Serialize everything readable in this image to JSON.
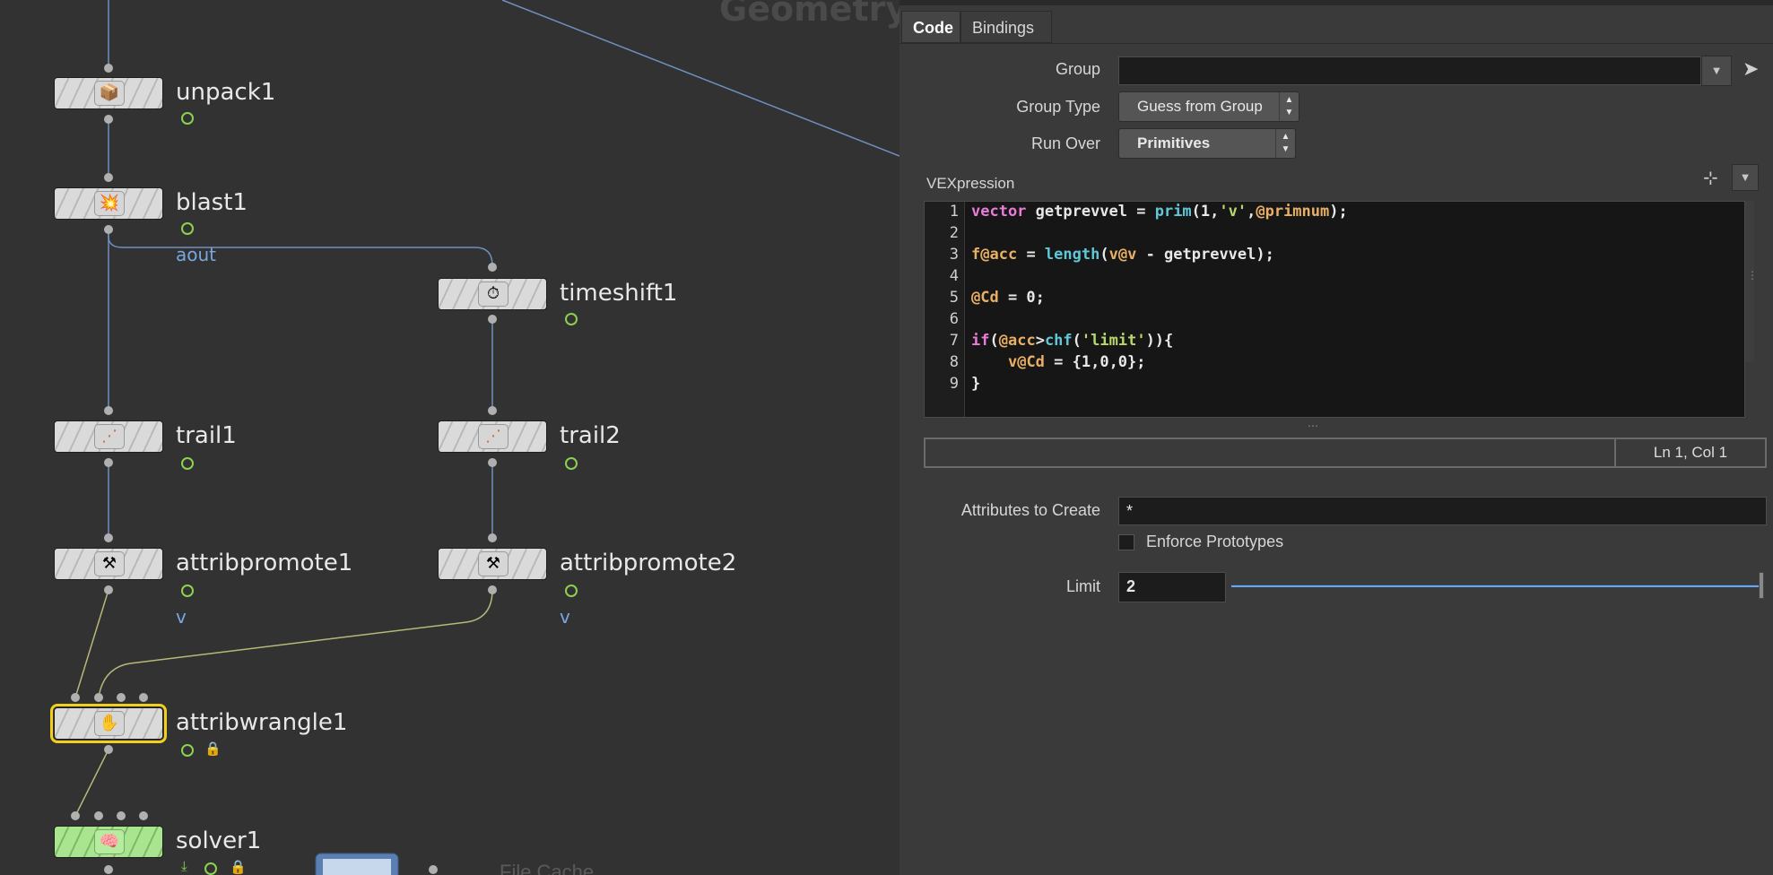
{
  "network": {
    "context_title": "Geometry",
    "nodes": {
      "unpack": {
        "name": "unpack1",
        "icon": "unpack-icon",
        "glyph": "📦"
      },
      "blast": {
        "name": "blast1",
        "icon": "blast-icon",
        "glyph": "💥",
        "output_label": "aout"
      },
      "timeshift": {
        "name": "timeshift1",
        "icon": "timeshift-icon",
        "glyph": "⏱"
      },
      "trail1": {
        "name": "trail1",
        "icon": "trail-icon",
        "glyph": "⋰"
      },
      "trail2": {
        "name": "trail2",
        "icon": "trail-icon",
        "glyph": "⋰"
      },
      "attribpromote1": {
        "name": "attribpromote1",
        "icon": "attribpromote-icon",
        "glyph": "⚒",
        "output_label": "v"
      },
      "attribpromote2": {
        "name": "attribpromote2",
        "icon": "attribpromote-icon",
        "glyph": "⚒",
        "output_label": "v"
      },
      "attribwrangle": {
        "name": "attribwrangle1",
        "icon": "attribwrangle-icon",
        "glyph": "✋"
      },
      "solver": {
        "name": "solver1",
        "icon": "solver-icon",
        "glyph": "🧠"
      }
    },
    "file_cache_label": "File Cache"
  },
  "panel": {
    "tabs": [
      "Code",
      "Bindings"
    ],
    "active_tab": "Code",
    "group": {
      "label": "Group",
      "value": ""
    },
    "group_type": {
      "label": "Group Type",
      "value": "Guess from Group"
    },
    "run_over": {
      "label": "Run Over",
      "value": "Primitives"
    },
    "vexpression_label": "VEXpression",
    "code_lines": [
      "vector getprevvel = prim(1,'v',@primnum);",
      "",
      "f@acc = length(v@v - getprevvel);",
      "",
      "@Cd = 0;",
      "",
      "if(@acc>chf('limit')){",
      "    v@Cd = {1,0,0};",
      "}"
    ],
    "line_numbers": [
      "1",
      "2",
      "3",
      "4",
      "5",
      "6",
      "7",
      "8",
      "9"
    ],
    "cursor_position": "Ln 1, Col 1",
    "attributes_to_create": {
      "label": "Attributes to Create",
      "value": "*"
    },
    "enforce_prototypes": {
      "label": "Enforce Prototypes",
      "checked": false
    },
    "limit": {
      "label": "Limit",
      "value": "2",
      "slider_fraction": 1.0
    }
  }
}
